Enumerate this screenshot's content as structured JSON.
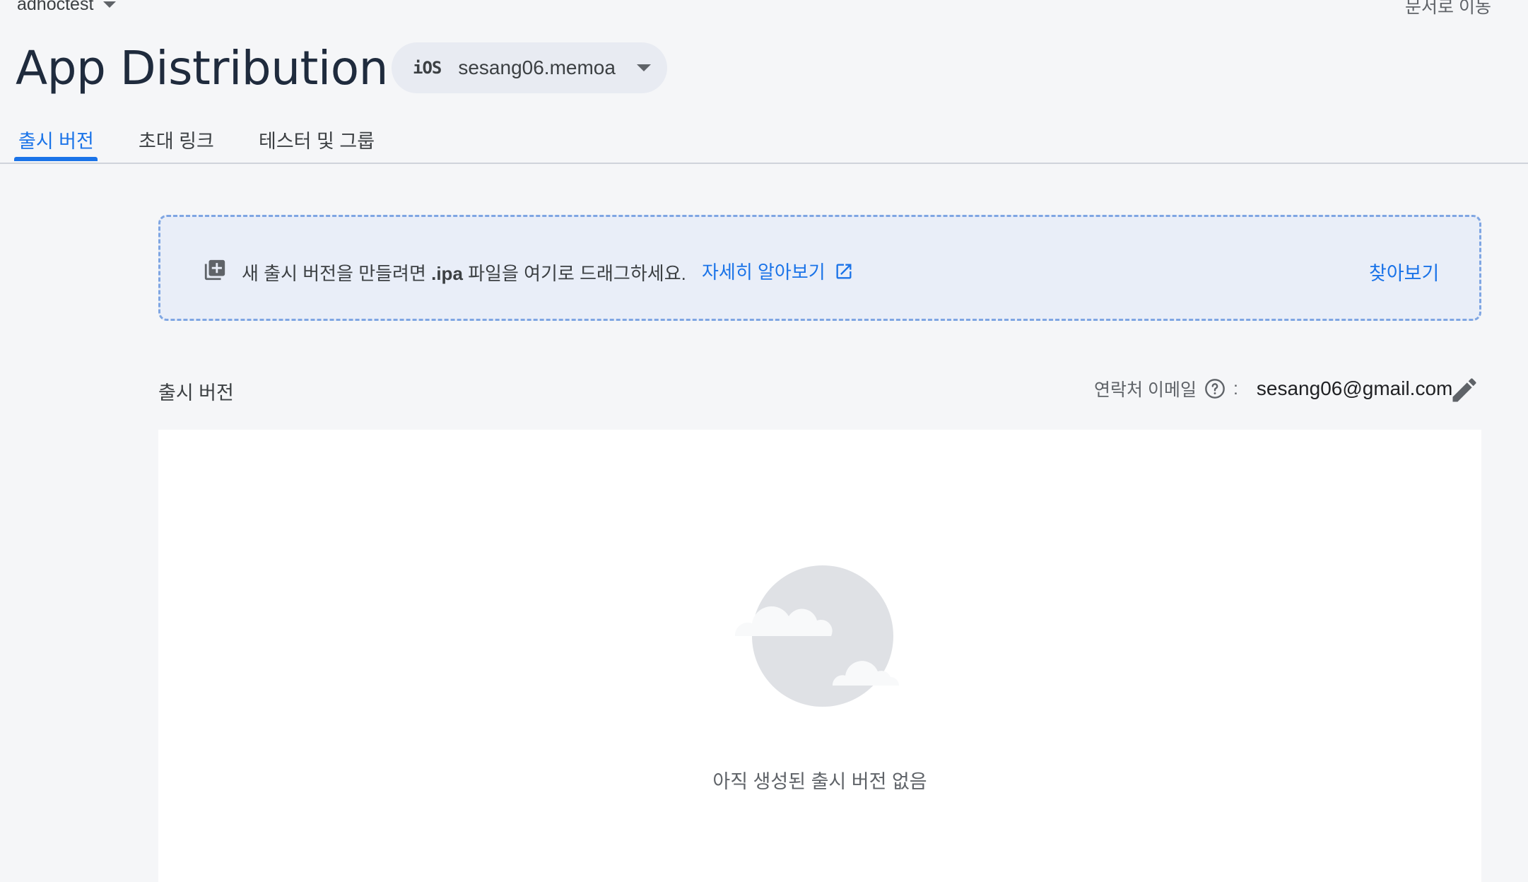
{
  "header": {
    "project_name": "adhoctest",
    "docs_link": "문서로 이동",
    "title": "App Distribution"
  },
  "app_selector": {
    "platform": "iOS",
    "app_id": "sesang06.memoa"
  },
  "tabs": [
    {
      "label": "출시 버전",
      "active": true
    },
    {
      "label": "초대 링크",
      "active": false
    },
    {
      "label": "테스터 및 그룹",
      "active": false
    }
  ],
  "dropzone": {
    "text_before": "새 출시 버전을 만들려면 ",
    "file_ext": ".ipa",
    "text_after": " 파일을 여기로 드래그하세요.",
    "learn_more": "자세히 알아보기",
    "browse": "찾아보기"
  },
  "releases": {
    "section_label": "출시 버전",
    "contact_label": "연락처 이메일",
    "contact_colon": ":",
    "contact_email": "sesang06@gmail.com",
    "empty_message": "아직 생성된 출시 버전 없음"
  },
  "colors": {
    "accent": "#1a73e8",
    "background": "#f5f6f8",
    "dropzone_bg": "#e9eef8",
    "dropzone_border": "#7fa6e3"
  },
  "icons": [
    "chevron-down-icon",
    "add-to-queue-icon",
    "open-in-new-icon",
    "help-circle-icon",
    "pencil-edit-icon",
    "cloud-illustration"
  ]
}
